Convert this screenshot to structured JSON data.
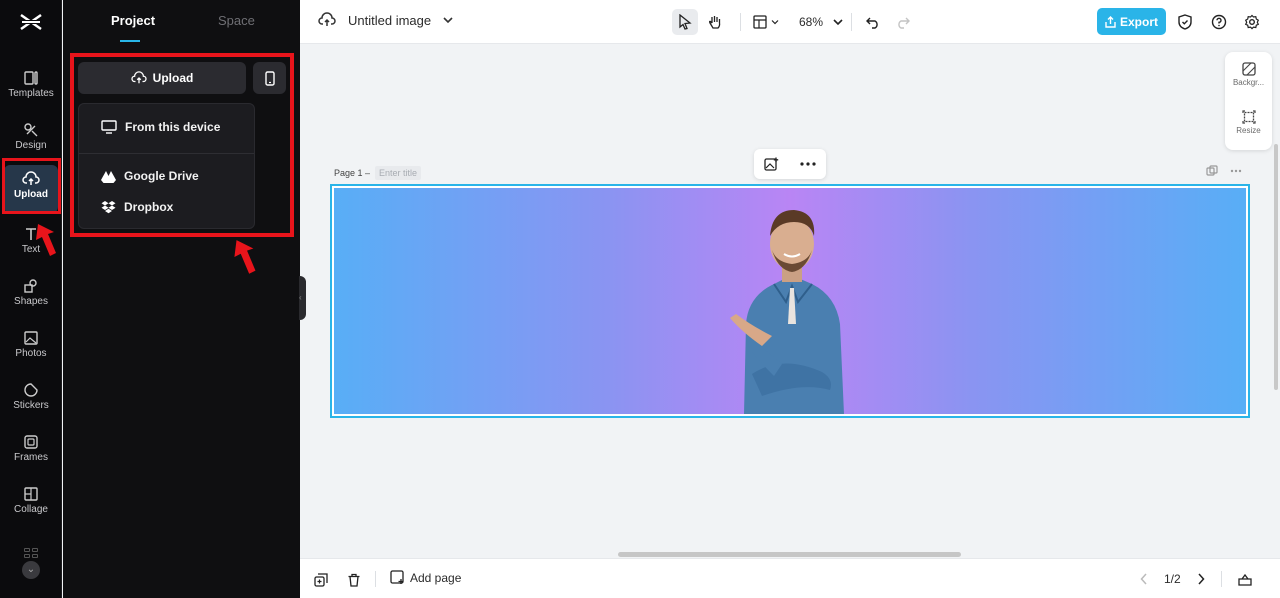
{
  "rail": {
    "items": [
      {
        "label": "Templates",
        "icon": "templates-icon"
      },
      {
        "label": "Design",
        "icon": "design-icon"
      },
      {
        "label": "Upload",
        "icon": "upload-cloud-icon"
      },
      {
        "label": "Text",
        "icon": "text-icon"
      },
      {
        "label": "Shapes",
        "icon": "shapes-icon"
      },
      {
        "label": "Photos",
        "icon": "photos-icon"
      },
      {
        "label": "Stickers",
        "icon": "stickers-icon"
      },
      {
        "label": "Frames",
        "icon": "frames-icon"
      },
      {
        "label": "Collage",
        "icon": "collage-icon"
      }
    ],
    "active": "Upload"
  },
  "panel": {
    "tabs": [
      "Project",
      "Space"
    ],
    "upload_label": "Upload",
    "menu": [
      "From this device",
      "Google Drive",
      "Dropbox"
    ]
  },
  "topbar": {
    "title": "Untitled image",
    "zoom": "68%",
    "export_label": "Export"
  },
  "float_panel": {
    "background_label": "Backgr...",
    "resize_label": "Resize"
  },
  "page": {
    "label": "Page 1 –",
    "title_placeholder": "Enter title"
  },
  "bottombar": {
    "add_page_label": "Add page",
    "page_counter": "1/2"
  },
  "colors": {
    "accent": "#2ab4e8",
    "annotation_red": "#e8141b",
    "panel_bg": "#0f0f11",
    "canvas_gradient_edge": "#58aef6",
    "canvas_gradient_center": "#b985f4"
  }
}
